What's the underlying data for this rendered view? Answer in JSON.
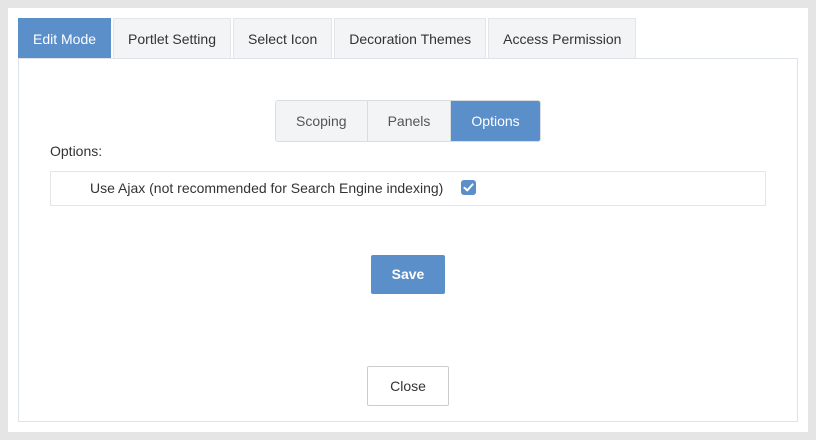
{
  "tabs": [
    {
      "label": "Edit Mode",
      "active": true
    },
    {
      "label": "Portlet Setting",
      "active": false
    },
    {
      "label": "Select Icon",
      "active": false
    },
    {
      "label": "Decoration Themes",
      "active": false
    },
    {
      "label": "Access Permission",
      "active": false
    }
  ],
  "subtabs": [
    {
      "label": "Scoping",
      "active": false
    },
    {
      "label": "Panels",
      "active": false
    },
    {
      "label": "Options",
      "active": true
    }
  ],
  "options": {
    "label": "Options:",
    "use_ajax": {
      "text": "Use Ajax (not recommended for Search Engine indexing)",
      "checked": true
    }
  },
  "buttons": {
    "save": "Save",
    "close": "Close"
  },
  "colors": {
    "accent": "#5b8fc9"
  },
  "icons": {
    "checkbox": "check-icon"
  }
}
